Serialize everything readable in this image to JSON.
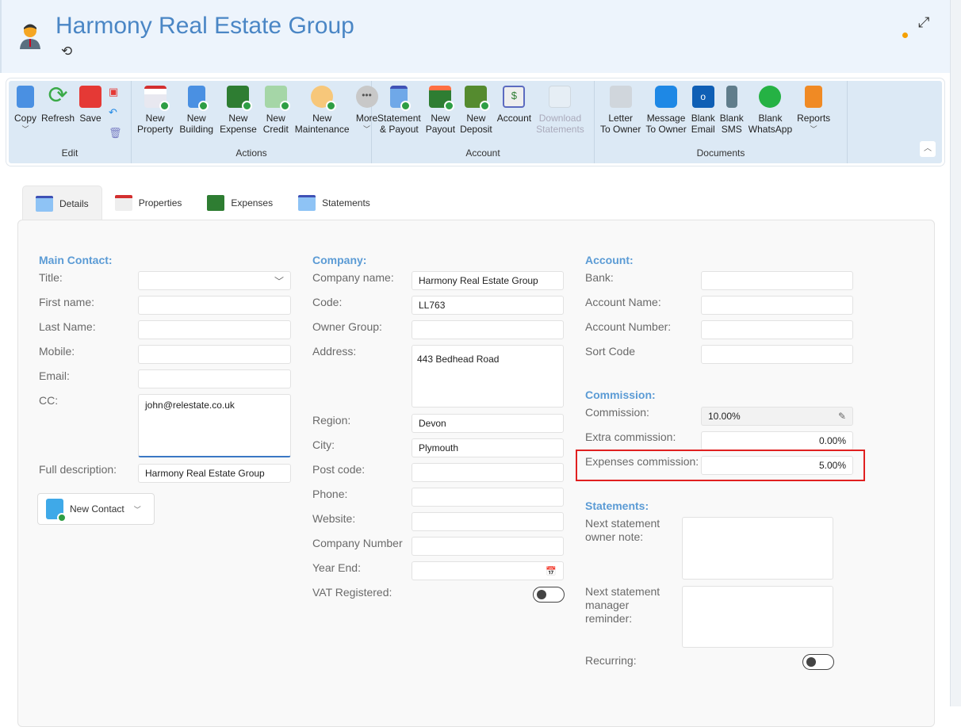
{
  "header": {
    "title": "Harmony Real Estate Group"
  },
  "ribbon": {
    "groups": [
      {
        "label": "Edit",
        "buttons": [
          "Copy",
          "Refresh",
          "Save"
        ]
      },
      {
        "label": "Actions",
        "buttons": [
          [
            "New",
            "Property"
          ],
          [
            "New",
            "Building"
          ],
          [
            "New",
            "Expense"
          ],
          [
            "New",
            "Credit"
          ],
          [
            "New",
            "Maintenance"
          ],
          [
            "More",
            ""
          ]
        ]
      },
      {
        "label": "Account",
        "buttons": [
          [
            "Statement",
            "& Payout"
          ],
          [
            "New",
            "Payout"
          ],
          [
            "New",
            "Deposit"
          ],
          [
            "Account",
            ""
          ],
          [
            "Download",
            "Statements"
          ]
        ]
      },
      {
        "label": "Documents",
        "buttons": [
          [
            "Letter",
            "To Owner"
          ],
          [
            "Message",
            "To Owner"
          ],
          [
            "Blank",
            "Email"
          ],
          [
            "Blank",
            "SMS"
          ],
          [
            "Blank",
            "WhatsApp"
          ],
          [
            "Reports",
            ""
          ]
        ]
      }
    ]
  },
  "tabs": [
    "Details",
    "Properties",
    "Expenses",
    "Statements"
  ],
  "main_contact": {
    "heading": "Main Contact:",
    "title_label": "Title:",
    "title_value": "",
    "first_name_label": "First name:",
    "last_name_label": "Last Name:",
    "mobile_label": "Mobile:",
    "email_label": "Email:",
    "cc_label": "CC:",
    "cc_value": "john@relestate.co.uk",
    "full_description_label": "Full description:",
    "full_description_value": "Harmony Real Estate Group",
    "new_contact_label": "New Contact"
  },
  "company": {
    "heading": "Company:",
    "name_label": "Company name:",
    "name_value": "Harmony Real Estate Group",
    "code_label": "Code:",
    "code_value": "LL763",
    "owner_group_label": "Owner Group:",
    "address_label": "Address:",
    "address_value": "443 Bedhead Road",
    "region_label": "Region:",
    "region_value": "Devon",
    "city_label": "City:",
    "city_value": "Plymouth",
    "post_code_label": "Post code:",
    "phone_label": "Phone:",
    "website_label": "Website:",
    "company_number_label": "Company Number",
    "year_end_label": "Year End:",
    "vat_label": "VAT Registered:",
    "vat_on": false
  },
  "account": {
    "heading": "Account:",
    "bank_label": "Bank:",
    "account_name_label": "Account Name:",
    "account_number_label": "Account Number:",
    "sort_code_label": "Sort Code"
  },
  "commission": {
    "heading": "Commission:",
    "commission_label": "Commission:",
    "commission_value": "10.00%",
    "extra_label": "Extra commission:",
    "extra_value": "0.00%",
    "expenses_label": "Expenses commission:",
    "expenses_value": "5.00%",
    "highlight_color": "#e02020"
  },
  "statements": {
    "heading": "Statements:",
    "owner_note_label": "Next statement owner note:",
    "manager_reminder_label": "Next statement manager reminder:",
    "recurring_label": "Recurring:",
    "recurring_on": false
  }
}
